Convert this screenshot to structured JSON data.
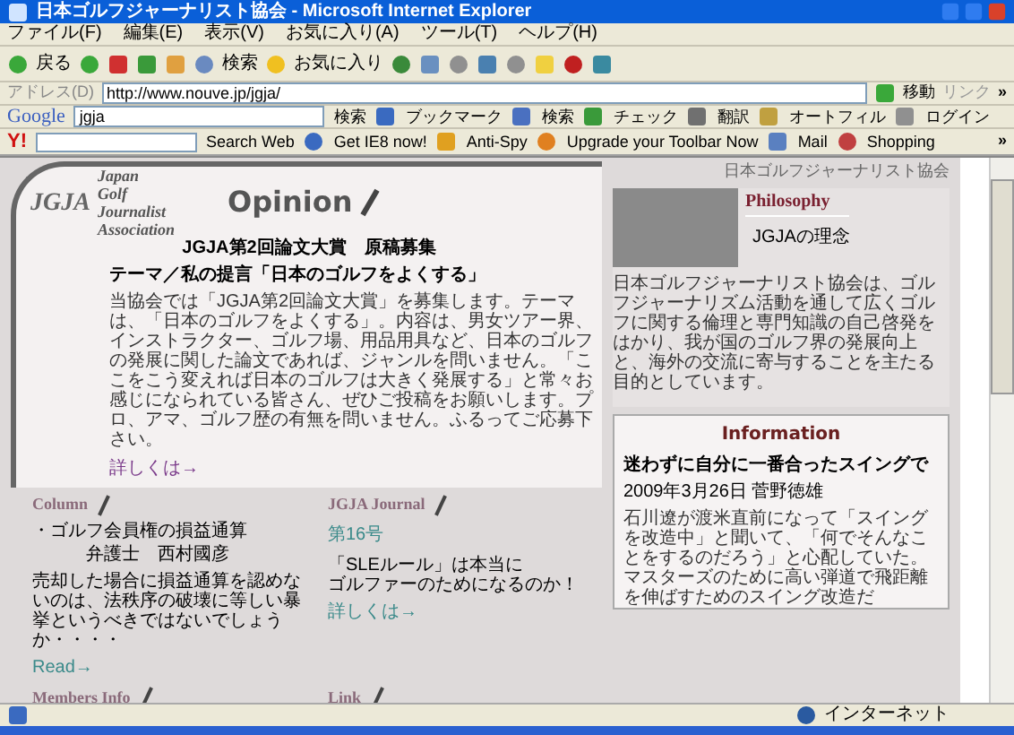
{
  "window": {
    "title": "日本ゴルフジャーナリスト協会 - Microsoft Internet Explorer"
  },
  "menu": [
    "ファイル(F)",
    "編集(E)",
    "表示(V)",
    "お気に入り(A)",
    "ツール(T)",
    "ヘルプ(H)"
  ],
  "toolbar": {
    "back": "戻る",
    "search": "検索",
    "favorites": "お気に入り"
  },
  "address_bar": {
    "label": "アドレス(D)",
    "url": "http://www.nouve.jp/jgja/",
    "go": "移動",
    "links": "リンク",
    "more": "»"
  },
  "google_toolbar": {
    "logo": "Google",
    "query": "jgja",
    "items": [
      "検索",
      "ブックマーク",
      "検索",
      "チェック",
      "翻訳",
      "オートフィル",
      "ログイン"
    ]
  },
  "yahoo_toolbar": {
    "logo": "Y!",
    "items": [
      "Search Web",
      "Get IE8 now!",
      "Anti-Spy",
      "Upgrade your Toolbar Now",
      "Mail",
      "Shopping"
    ],
    "more": "»"
  },
  "page": {
    "site_name": "日本ゴルフジャーナリスト協会",
    "logo": {
      "mark": "JGJA",
      "lines": [
        "Japan",
        "Golf",
        "Journalist",
        "Association"
      ]
    },
    "opinion": {
      "heading": "Opinion",
      "headline": "JGJA第2回論文大賞　原稿募集",
      "theme": "テーマ／私の提言「日本のゴルフをよくする」",
      "body": "当協会では「JGJA第2回論文大賞」を募集します。テーマは、「日本のゴルフをよくする」。内容は、男女ツアー界、インストラクター、ゴルフ場、用品用具など、日本のゴルフの発展に関した論文であれば、ジャンルを問いません。「ここをこう変えれば日本のゴルフは大きく発展する」と常々お感じになられている皆さん、ぜひご投稿をお願いします。プロ、アマ、ゴルフ歴の有無を問いません。ふるってご応募下さい。",
      "link": "詳しくは→"
    },
    "philosophy": {
      "heading": "Philosophy",
      "subtitle": "JGJAの理念",
      "body": "日本ゴルフジャーナリスト協会は、ゴルフジャーナリズム活動を通して広くゴルフに関する倫理と専門知識の自己啓発をはかり、我が国のゴルフ界の発展向上と、海外の交流に寄与することを主たる目的としています。"
    },
    "column": {
      "heading": "Column",
      "title": "・ゴルフ会員権の損益通算",
      "author": "弁護士　西村國彦",
      "body": "売却した場合に損益通算を認めないのは、法秩序の破壊に等しい暴挙というべきではないでしょうか・・・・",
      "link": "Read→"
    },
    "journal": {
      "heading": "JGJA Journal",
      "issue": "第16号",
      "body_lines": [
        "「SLEルール」は本当に",
        "ゴルファーのためになるのか！"
      ],
      "link": "詳しくは→"
    },
    "members_info": {
      "heading": "Members Info"
    },
    "links_section": {
      "heading": "Link"
    },
    "information": {
      "heading": "Information",
      "title": "迷わずに自分に一番合ったスイングで",
      "date": "2009年3月26日 菅野徳雄",
      "body": "石川遼が渡米直前になって「スイングを改造中」と聞いて、「何でそんなことをするのだろう」と心配していた。マスターズのために高い弾道で飛距離を伸ばすためのスイング改造だ"
    }
  },
  "status_bar": {
    "zone": "インターネット"
  }
}
